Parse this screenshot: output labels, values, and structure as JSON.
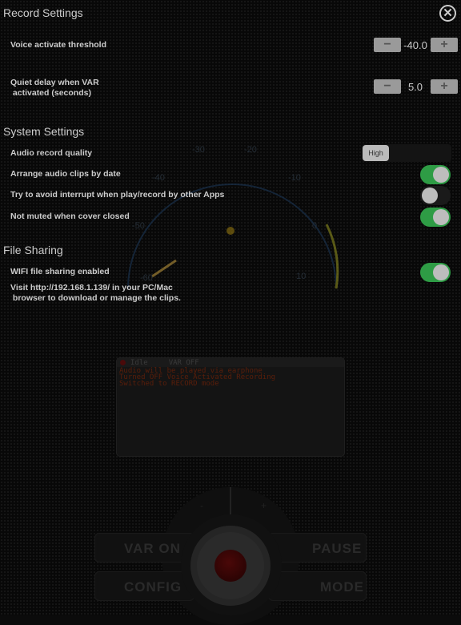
{
  "record_settings": {
    "title": "Record Settings",
    "threshold": {
      "label": "Voice activate threshold",
      "value": "-40.0",
      "minus": "−",
      "plus": "+"
    },
    "quiet_delay": {
      "label_line1": "Quiet delay when VAR",
      "label_line2": " activated (seconds)",
      "value": "5.0",
      "minus": "−",
      "plus": "+"
    }
  },
  "system_settings": {
    "title": "System Settings",
    "quality": {
      "label": "Audio record quality",
      "selected": "High"
    },
    "arrange": {
      "label": "Arrange audio clips by date",
      "on": true
    },
    "avoid_interrupt": {
      "label": "Try to avoid interrupt when play/record by other Apps",
      "on": false
    },
    "not_muted": {
      "label": "Not muted when cover closed",
      "on": true
    }
  },
  "file_sharing": {
    "title": "File Sharing",
    "wifi": {
      "label": "WIFI file sharing enabled",
      "on": true
    },
    "visit_line1": "Visit http://192.168.1.139/ in your PC/Mac",
    "visit_line2": " browser to download or manage the clips."
  },
  "gauge": {
    "ticks": [
      "-60",
      "-50",
      "-40",
      "-30",
      "-20",
      "-10",
      "0",
      "10"
    ]
  },
  "console": {
    "status": "Idle",
    "var": "VAR OFF",
    "lines": [
      "Audio will be played via earphone",
      "Turned OFF Voice Activated Recording",
      "Switched to RECORD mode"
    ]
  },
  "controls": {
    "var_on": "VAR ON",
    "pause": "PAUSE",
    "config": "CONFIG",
    "mode": "MODE",
    "vol_minus": "-",
    "vol_plus": "+"
  },
  "colors": {
    "toggle_on": "#2e9c45",
    "gauge_arc": "#1c3a5c",
    "console_text": "#5a1e0a"
  }
}
